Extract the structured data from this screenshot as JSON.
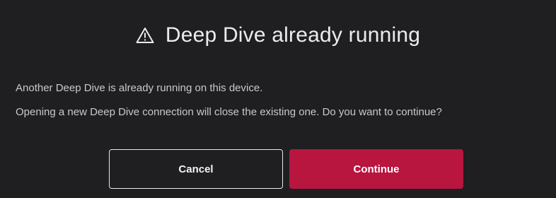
{
  "dialog": {
    "title": "Deep Dive already running",
    "title_icon": "warning-triangle-icon",
    "message_line1": "Another Deep Dive is already running on this device.",
    "message_line2": "Opening a new Deep Dive connection will close the existing one. Do you want to continue?",
    "cancel_label": "Cancel",
    "continue_label": "Continue"
  },
  "colors": {
    "background": "#1f1f21",
    "text": "#c9c9cb",
    "accent": "#b8153f"
  }
}
